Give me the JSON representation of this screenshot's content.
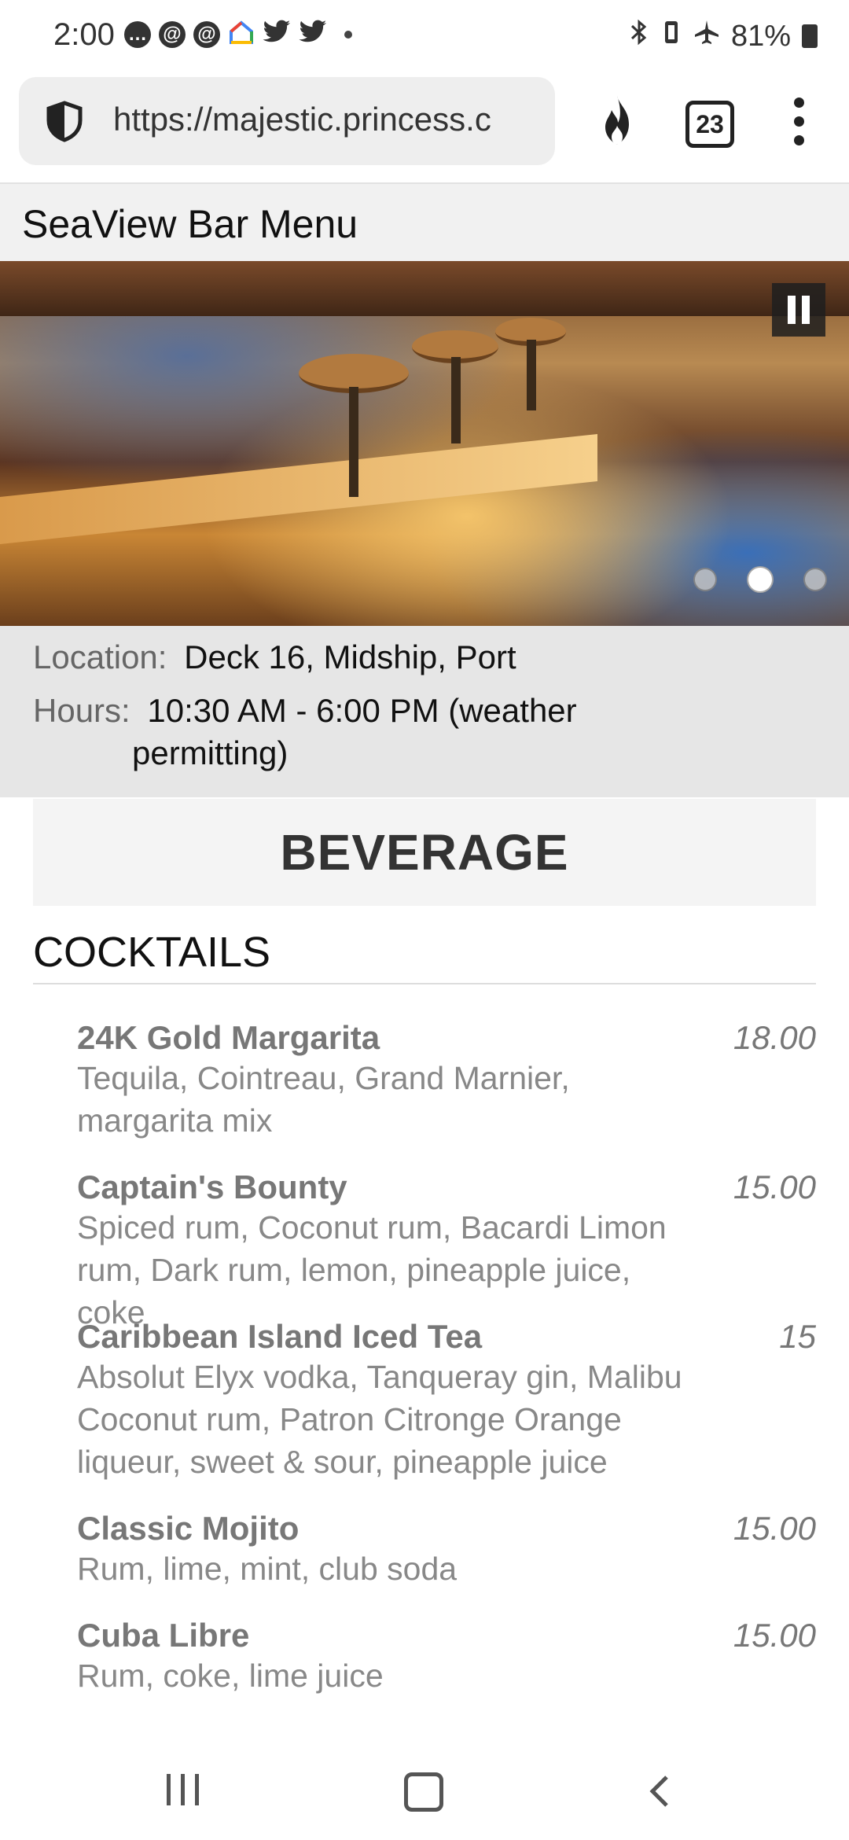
{
  "status_bar": {
    "time": "2:00",
    "battery": "81%",
    "icons": [
      "chat-icon",
      "threads-icon",
      "threads-icon",
      "google-home-icon",
      "twitter-icon",
      "twitter-icon",
      "dot-icon",
      "bluetooth-icon",
      "vibrate-icon",
      "airplane-icon",
      "battery-icon"
    ]
  },
  "browser": {
    "url": "https://majestic.princess.c",
    "tab_count": "23"
  },
  "page": {
    "title": "SeaView Bar Menu"
  },
  "info": {
    "location_label": "Location:",
    "location_value": "Deck 16, Midship, Port",
    "hours_label": "Hours:",
    "hours_value_line1": "10:30 AM - 6:00 PM (weather",
    "hours_value_line2": "permitting)"
  },
  "menu": {
    "section_title": "BEVERAGE",
    "category": "COCKTAILS",
    "items": [
      {
        "name": "24K Gold Margarita",
        "price": "18.00",
        "desc": "Tequila, Cointreau, Grand Marnier, margarita mix"
      },
      {
        "name": "Captain's Bounty",
        "price": "15.00",
        "desc": "Spiced rum, Coconut rum, Bacardi Limon rum, Dark rum, lemon, pineapple juice, coke"
      },
      {
        "name": "Caribbean Island Iced Tea",
        "price": "15",
        "desc": "Absolut Elyx vodka, Tanqueray gin, Malibu Coconut rum, Patron Citronge Orange liqueur, sweet & sour, pineapple juice"
      },
      {
        "name": "Classic Mojito",
        "price": "15.00",
        "desc": "Rum, lime, mint, club soda"
      },
      {
        "name": "Cuba Libre",
        "price": "15.00",
        "desc": "Rum, coke, lime juice"
      }
    ]
  },
  "carousel": {
    "slide_count": 3,
    "active_index": 1
  }
}
